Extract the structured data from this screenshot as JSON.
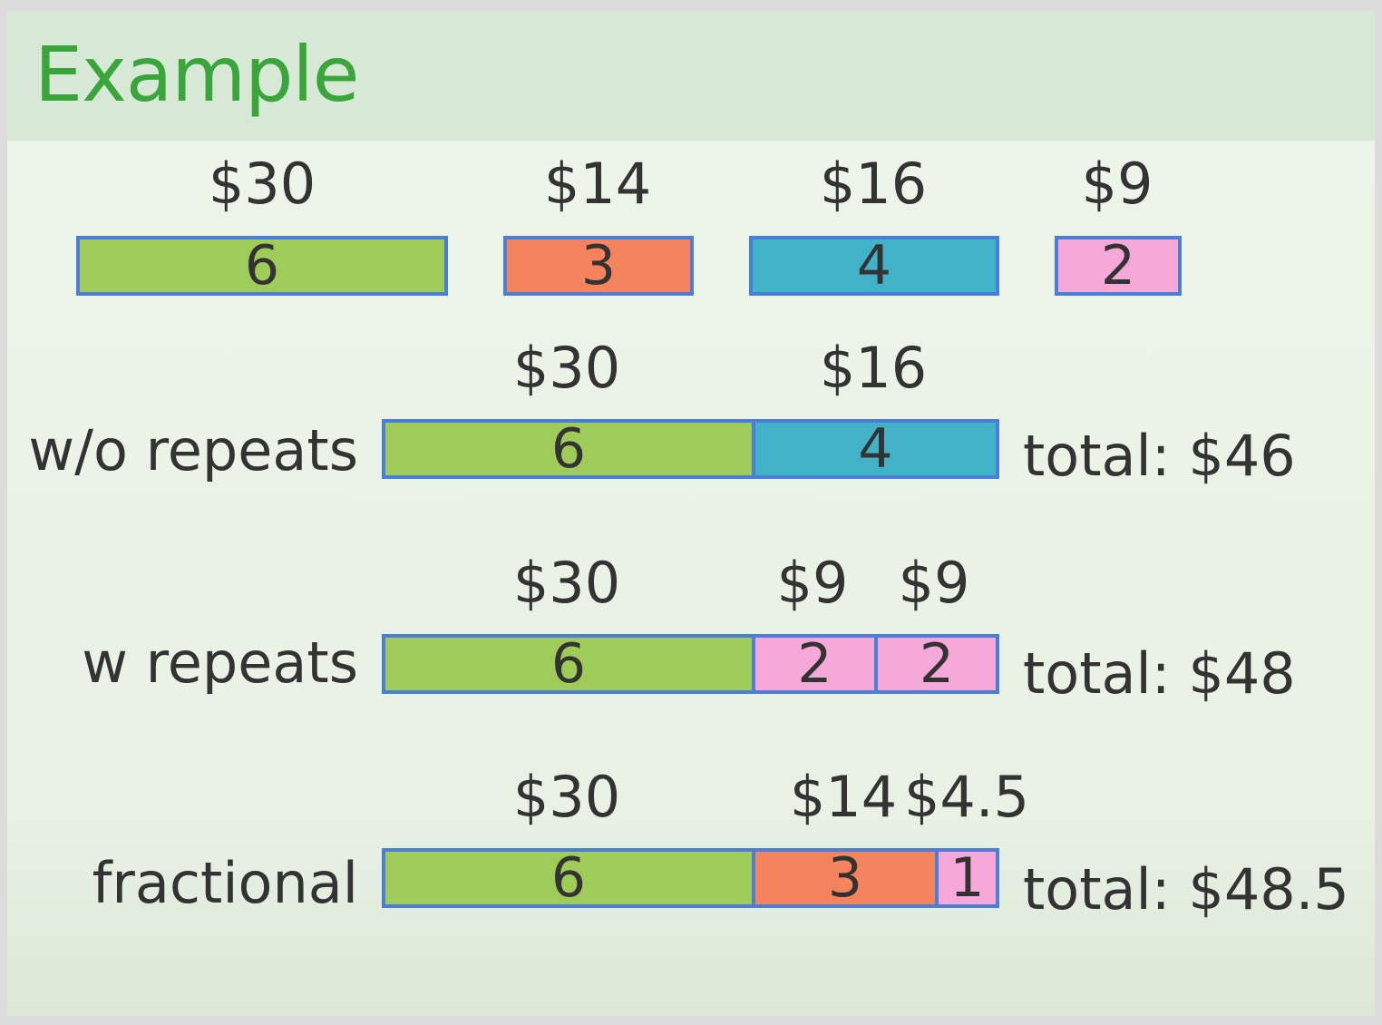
{
  "slide": {
    "title": "Example"
  },
  "items": [
    {
      "price": "$30",
      "weight": "6",
      "color": "#9fcb58"
    },
    {
      "price": "$14",
      "weight": "3",
      "color": "#f5845e"
    },
    {
      "price": "$16",
      "weight": "4",
      "color": "#42b2c8"
    },
    {
      "price": "$9",
      "weight": "2",
      "color": "#f6a8d9"
    }
  ],
  "rows": [
    {
      "label": "w/o repeats",
      "prices": [
        "$30",
        "$16"
      ],
      "segments": [
        "6",
        "4"
      ],
      "total": "total: $46"
    },
    {
      "label": "w repeats",
      "prices": [
        "$30",
        "$9",
        "$9"
      ],
      "segments": [
        "6",
        "2",
        "2"
      ],
      "total": "total: $48"
    },
    {
      "label": "fractional",
      "prices": [
        "$30",
        "$14",
        "$4.5"
      ],
      "segments": [
        "6",
        "3",
        "1"
      ],
      "total": "total: $48.5"
    }
  ]
}
